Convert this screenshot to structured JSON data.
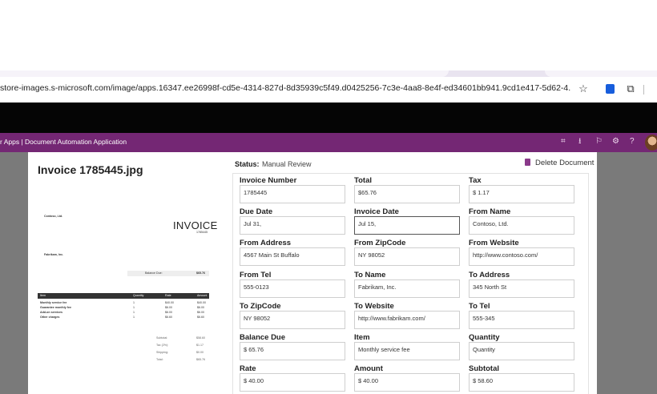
{
  "browser": {
    "url": "store-images.s-microsoft.com/image/apps.16347.ee26998f-cd5e-4314-827d-8d35939c5f49.d0425256-7c3e-4aa8-8e4f-ed34601bb941.9cd1e417-5d62-4...",
    "star_icon": "star-icon",
    "icons": [
      "bitwarden-icon",
      "extensions-icon"
    ]
  },
  "app": {
    "title": "r Apps | Document Automation Application",
    "accent": "#742774"
  },
  "document": {
    "title": "Invoice 1785445.jpg",
    "status_label": "Status:",
    "status_value": "Manual Review",
    "delete_label": "Delete Document"
  },
  "preview": {
    "heading": "INVOICE",
    "number": "1785445",
    "company": "Contoso, Ltd.",
    "bill_to": "Fabrikam, Inc.",
    "balance_label": "Balance Due:",
    "balance_value": "$65.76",
    "table_header": [
      "Item",
      "Quantity",
      "Rate",
      "Amount"
    ],
    "rows": [
      [
        "Monthly service fee",
        "1",
        "$40.00",
        "$40.00"
      ],
      [
        "Guarantee monthly fee",
        "1",
        "$6.00",
        "$6.00"
      ],
      [
        "Add-on services",
        "1",
        "$6.00",
        "$6.00"
      ],
      [
        "Other charges",
        "1",
        "$6.60",
        "$6.60"
      ]
    ],
    "totals": [
      [
        "Subtotal:",
        "$58.60"
      ],
      [
        "Tax (2%):",
        "$1.17"
      ],
      [
        "Shipping:",
        "$0.00"
      ],
      [
        "Total:",
        "$65.76"
      ]
    ]
  },
  "fields": [
    {
      "label": "Invoice Number",
      "value": "1785445"
    },
    {
      "label": "Total",
      "value": "$65.76"
    },
    {
      "label": "Tax",
      "value": "$ 1.17"
    },
    {
      "label": "Due Date",
      "value": "Jul 31,"
    },
    {
      "label": "Invoice Date",
      "value": "Jul 15,"
    },
    {
      "label": "From Name",
      "value": "Contoso, Ltd."
    },
    {
      "label": "From Address",
      "value": "4567 Main St Buffalo"
    },
    {
      "label": "From ZipCode",
      "value": "NY 98052"
    },
    {
      "label": "From Website",
      "value": "http://www.contoso.com/"
    },
    {
      "label": "From Tel",
      "value": "555-0123"
    },
    {
      "label": "To Name",
      "value": "Fabrikam, Inc."
    },
    {
      "label": "To Address",
      "value": "345 North St"
    },
    {
      "label": "To ZipCode",
      "value": "NY 98052"
    },
    {
      "label": "To Website",
      "value": "http://www.fabrikam.com/"
    },
    {
      "label": "To Tel",
      "value": "555-345"
    },
    {
      "label": "Balance Due",
      "value": "$ 65.76"
    },
    {
      "label": "Item",
      "value": "Monthly service fee"
    },
    {
      "label": "Quantity",
      "value": "Quantity"
    },
    {
      "label": "Rate",
      "value": "$ 40.00"
    },
    {
      "label": "Amount",
      "value": "$ 40.00"
    },
    {
      "label": "Subtotal",
      "value": "$ 58.60"
    }
  ]
}
